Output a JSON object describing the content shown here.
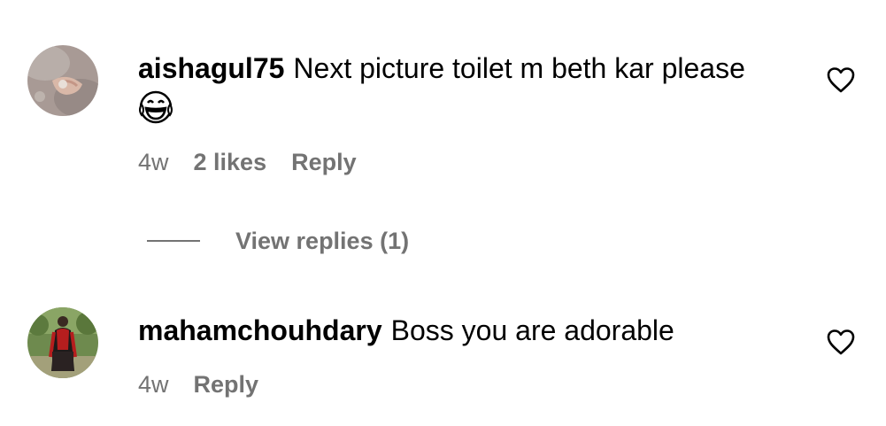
{
  "comments": [
    {
      "username": "aishagul75",
      "text": "Next picture toilet m beth kar please",
      "emoji": "joy-emoji",
      "time": "4w",
      "likes": "2 likes",
      "reply_label": "Reply",
      "view_replies": "View replies (1)"
    },
    {
      "username": "mahamchouhdary",
      "text": "Boss you are adorable",
      "time": "4w",
      "reply_label": "Reply"
    }
  ],
  "colors": {
    "text": "#000000",
    "muted": "#737373",
    "background": "#ffffff"
  }
}
